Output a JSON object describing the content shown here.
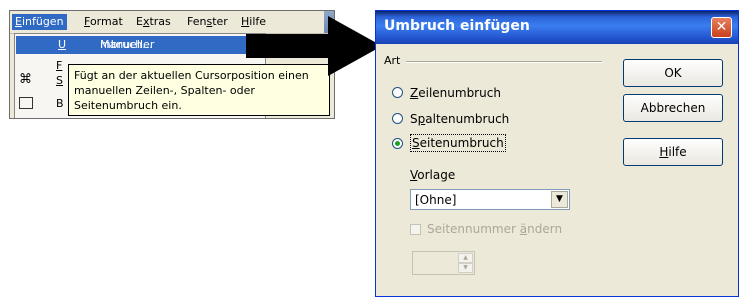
{
  "menubar": {
    "items": [
      {
        "label": "Einfügen",
        "accel": "E",
        "rest": "infügen"
      },
      {
        "label": "Format",
        "accel": "F",
        "rest": "ormat"
      },
      {
        "label": "Extras",
        "pre": "E",
        "accel": "x",
        "rest": "tras"
      },
      {
        "label": "Fenster",
        "pre": "Fen",
        "accel": "s",
        "rest": "ter"
      },
      {
        "label": "Hilfe",
        "accel": "H",
        "rest": "ilfe"
      }
    ]
  },
  "dropdown": {
    "highlighted": {
      "pre": "Manueller ",
      "accel": "U",
      "rest": "mbruch..."
    },
    "partial_1": "F",
    "partial_2": "S",
    "partial_3": "B"
  },
  "tooltip": {
    "lines": [
      "Fügt an der aktuellen Cursorposition einen",
      "manuellen Zeilen-, Spalten- oder",
      "Seitenumbruch ein."
    ]
  },
  "dialog": {
    "title": "Umbruch einfügen",
    "group_label": "Art",
    "options": [
      {
        "accel": "Z",
        "rest": "eilenumbruch",
        "selected": false
      },
      {
        "pre": "S",
        "accel": "p",
        "rest": "altenumbruch",
        "selected": false
      },
      {
        "accel": "S",
        "rest": "eitenumbruch",
        "selected": true
      }
    ],
    "style_label": {
      "accel": "V",
      "rest": "orlage"
    },
    "style_value": "[Ohne]",
    "page_number_label": {
      "pre": "Seitennummer ",
      "accel": "ä",
      "rest": "ndern"
    },
    "page_number_value": "",
    "buttons": {
      "ok": "OK",
      "cancel": "Abbrechen",
      "help": {
        "accel": "H",
        "rest": "ilfe"
      }
    }
  },
  "colors": {
    "titlebar": "#2456cf",
    "menu_highlight": "#316ac5",
    "tooltip_bg": "#ffffe1",
    "dialog_bg": "#ece9d8",
    "radio_dot": "#21a121"
  }
}
